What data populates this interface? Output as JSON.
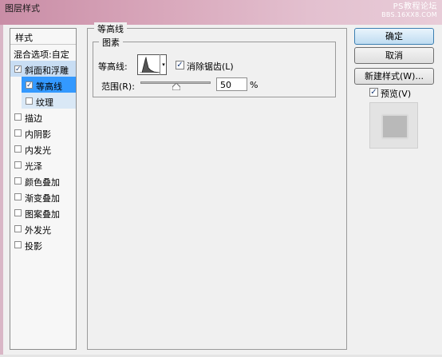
{
  "window": {
    "title": "图层样式"
  },
  "watermark": {
    "line1": "PS教程论坛",
    "line2": "BBS.16XX8.COM"
  },
  "style_list": {
    "header": "样式",
    "blend_options": "混合选项:自定",
    "items": [
      {
        "label": "斜面和浮雕",
        "checked": true
      },
      {
        "label": "等高线",
        "checked": true
      },
      {
        "label": "纹理",
        "checked": false
      },
      {
        "label": "描边",
        "checked": false
      },
      {
        "label": "内阴影",
        "checked": false
      },
      {
        "label": "内发光",
        "checked": false
      },
      {
        "label": "光泽",
        "checked": false
      },
      {
        "label": "颜色叠加",
        "checked": false
      },
      {
        "label": "渐变叠加",
        "checked": false
      },
      {
        "label": "图案叠加",
        "checked": false
      },
      {
        "label": "外发光",
        "checked": false
      },
      {
        "label": "投影",
        "checked": false
      }
    ]
  },
  "panel": {
    "group_title": "等高线",
    "subgroup_title": "图素",
    "contour_label": "等高线:",
    "antialias_label": "消除锯齿(L)",
    "antialias_checked": true,
    "range_label": "范围(R):",
    "range_value": "50",
    "range_unit": "%"
  },
  "buttons": {
    "ok": "确定",
    "cancel": "取消",
    "new_style": "新建样式(W)..."
  },
  "preview": {
    "label": "预览(V)",
    "checked": true
  },
  "colors": {
    "titlebar_accent": "#c98da6",
    "selection": "#3399ff",
    "highlight": "#c8ddf3"
  }
}
